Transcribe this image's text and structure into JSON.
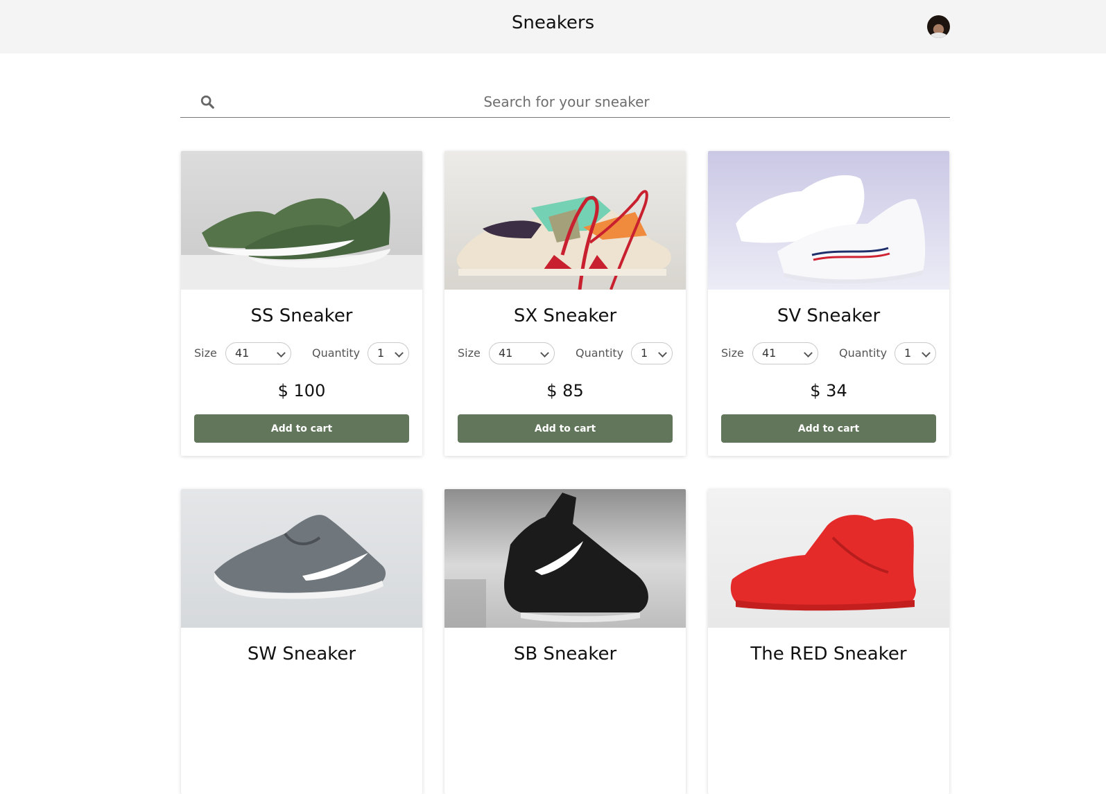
{
  "header": {
    "title": "Sneakers"
  },
  "search": {
    "placeholder": "Search for your sneaker",
    "icon": "search-icon"
  },
  "accent_color": "#61765a",
  "products": [
    {
      "name": "SS Sneaker",
      "size_label": "Size",
      "size_value": "41",
      "quantity_label": "Quantity",
      "quantity_value": "1",
      "price": "$ 100",
      "button_label": "Add to cart"
    },
    {
      "name": "SX Sneaker",
      "size_label": "Size",
      "size_value": "41",
      "quantity_label": "Quantity",
      "quantity_value": "1",
      "price": "$ 85",
      "button_label": "Add to cart"
    },
    {
      "name": "SV Sneaker",
      "size_label": "Size",
      "size_value": "41",
      "quantity_label": "Quantity",
      "quantity_value": "1",
      "price": "$ 34",
      "button_label": "Add to cart"
    },
    {
      "name": "SW Sneaker"
    },
    {
      "name": "SB Sneaker"
    },
    {
      "name": "The RED Sneaker"
    }
  ]
}
